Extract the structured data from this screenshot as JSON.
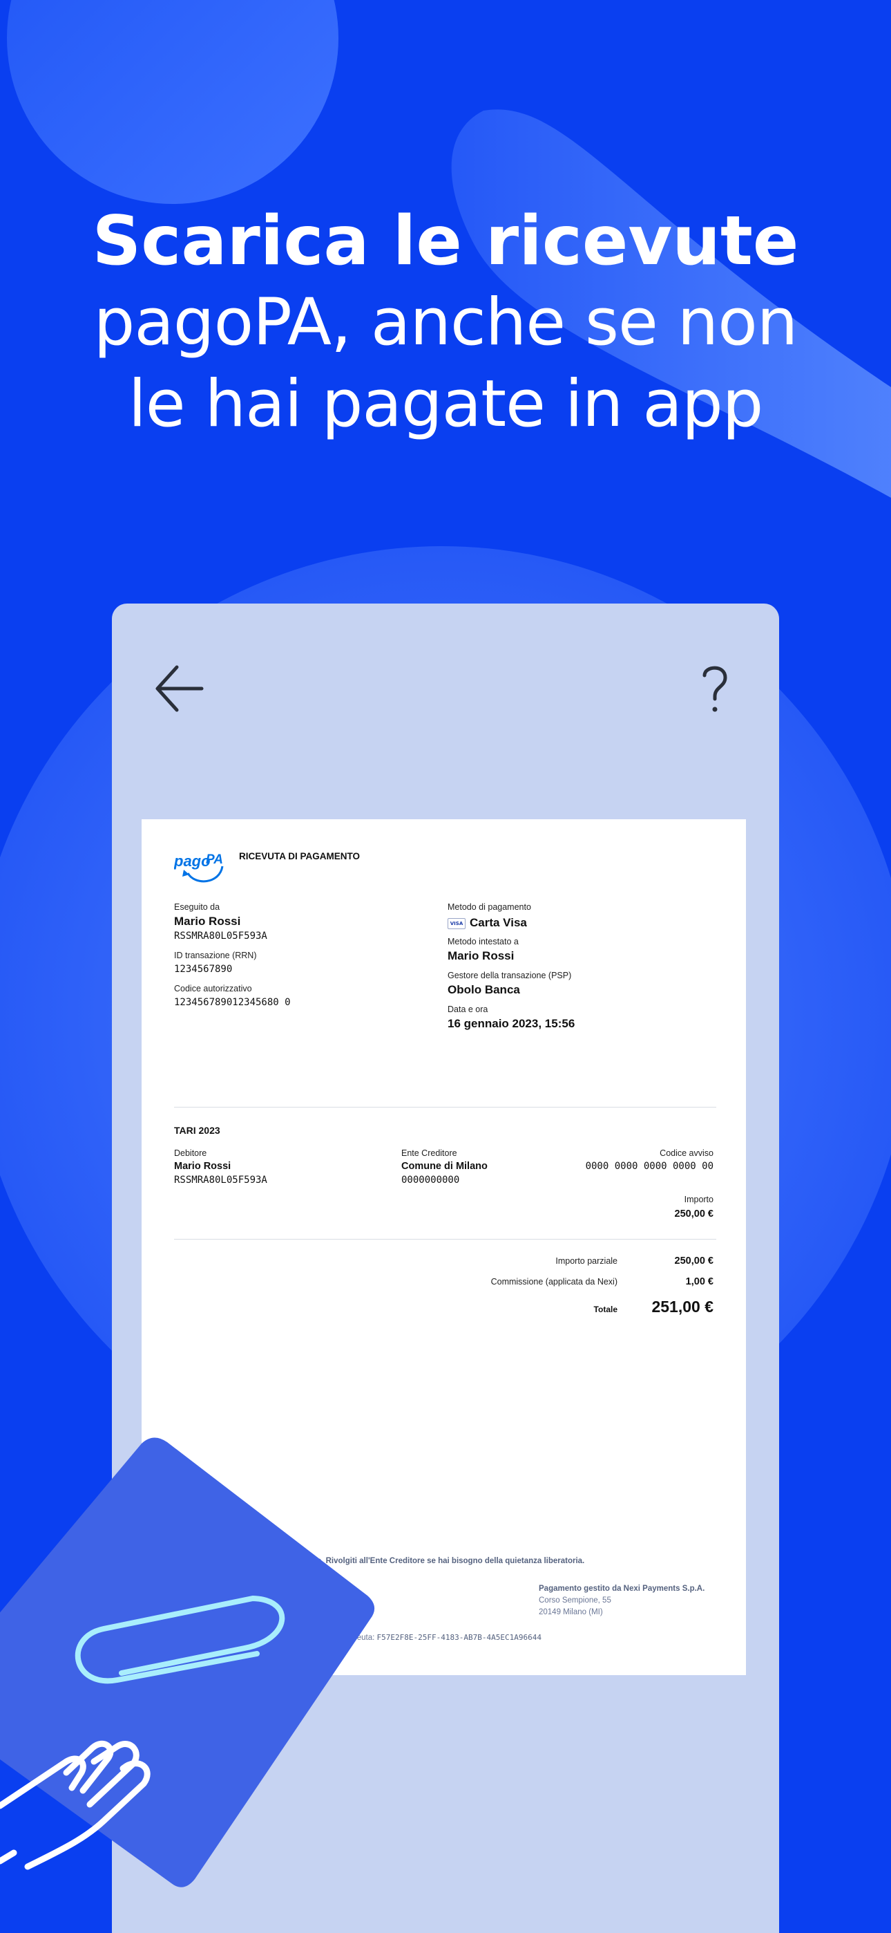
{
  "headline": {
    "line1": "Scarica le ricevute",
    "line2": "pagoPA, anche se non",
    "line3": "le hai pagate in app"
  },
  "colors": {
    "background": "#0a3ff0",
    "phone_screen": "#c6d3f2",
    "card": "#3f63e6",
    "clip": "#a9eefc",
    "pagopa_logo": "#0073e6"
  },
  "nav": {
    "back_icon": "arrow-left-icon",
    "help_icon": "question-mark-icon"
  },
  "receipt": {
    "logo_text": "pagoPA",
    "title": "RICEVUTA DI PAGAMENTO",
    "executed_by_label": "Eseguito da",
    "executed_by_name": "Mario Rossi",
    "executed_by_code": "RSSMRA80L05F593A",
    "transaction_id_label": "ID transazione (RRN)",
    "transaction_id": "1234567890",
    "auth_code_label": "Codice autorizzativo",
    "auth_code": "123456789012345680 0",
    "payment_method_label": "Metodo di pagamento",
    "card_brand": "VISA",
    "payment_method": "Carta Visa",
    "holder_label": "Metodo intestato a",
    "holder_name": "Mario Rossi",
    "psp_label": "Gestore della transazione (PSP)",
    "psp_name": "Obolo Banca",
    "datetime_label": "Data e ora",
    "datetime": "16 gennaio 2023, 15:56",
    "item_title": "TARI 2023",
    "debtor_label": "Debitore",
    "debtor_name": "Mario Rossi",
    "debtor_code": "RSSMRA80L05F593A",
    "creditor_label": "Ente Creditore",
    "creditor_name": "Comune di Milano",
    "creditor_code": "0000000000",
    "notice_label": "Codice avviso",
    "notice_code": "0000 0000 0000 0000 00",
    "amount_label": "Importo",
    "amount": "250,00 €",
    "partial_label": "Importo parziale",
    "partial_amount": "250,00 €",
    "fee_label": "Commissione (applicata da Nexi)",
    "fee_amount": "1,00 €",
    "total_label": "Totale",
    "total_amount": "251,00 €",
    "disclaimer": "lo. Rivolgiti all'Ente Creditore se hai bisogno della quietanza liberatoria.",
    "managed_by": "Pagamento gestito da Nexi Payments S.p.A.",
    "address_line1": "Corso Sempione, 55",
    "address_line2": "20149 Milano (MI)",
    "receipt_id_prefix": "ceuta:",
    "receipt_id": "F57E2F8E-25FF-4183-AB7B-4A5EC1A96644"
  }
}
